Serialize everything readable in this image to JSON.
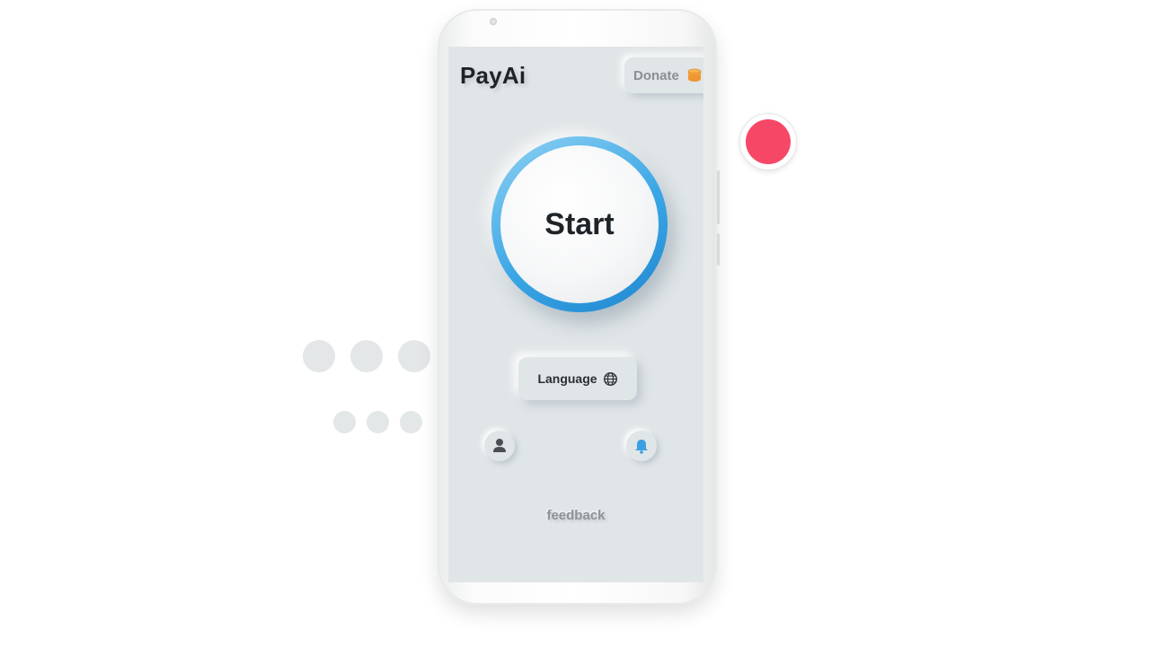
{
  "app": {
    "title": "PayAi",
    "donate_label": "Donate",
    "start_label": "Start",
    "language_label": "Language",
    "feedback_label": "feedback"
  },
  "icons": {
    "donate": "coin-stack-icon",
    "language": "globe-icon",
    "left_round": "user-icon",
    "right_round": "bell-icon"
  },
  "colors": {
    "screen_bg": "#e0e5e7",
    "start_ring": "#3aa6e5",
    "record_dot": "#f64866",
    "donate_icon": "#f4a640",
    "bell_icon": "#3aa0e0"
  }
}
